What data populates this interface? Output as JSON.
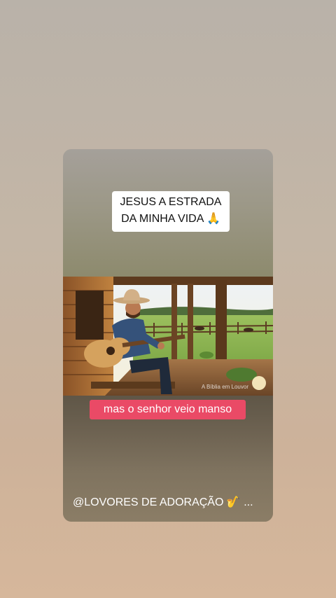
{
  "video": {
    "title_line1": "JESUS A ESTRADA",
    "title_line2": "DA MINHA VIDA 🙏",
    "watermark": "A Bíblia em Louvor",
    "subtitle": "mas o senhor veio manso",
    "channel": "@LOVORES DE ADORAÇÃO 🎷 ..."
  },
  "colors": {
    "caption_bg": "#ea4a66",
    "title_bg": "#ffffff"
  }
}
